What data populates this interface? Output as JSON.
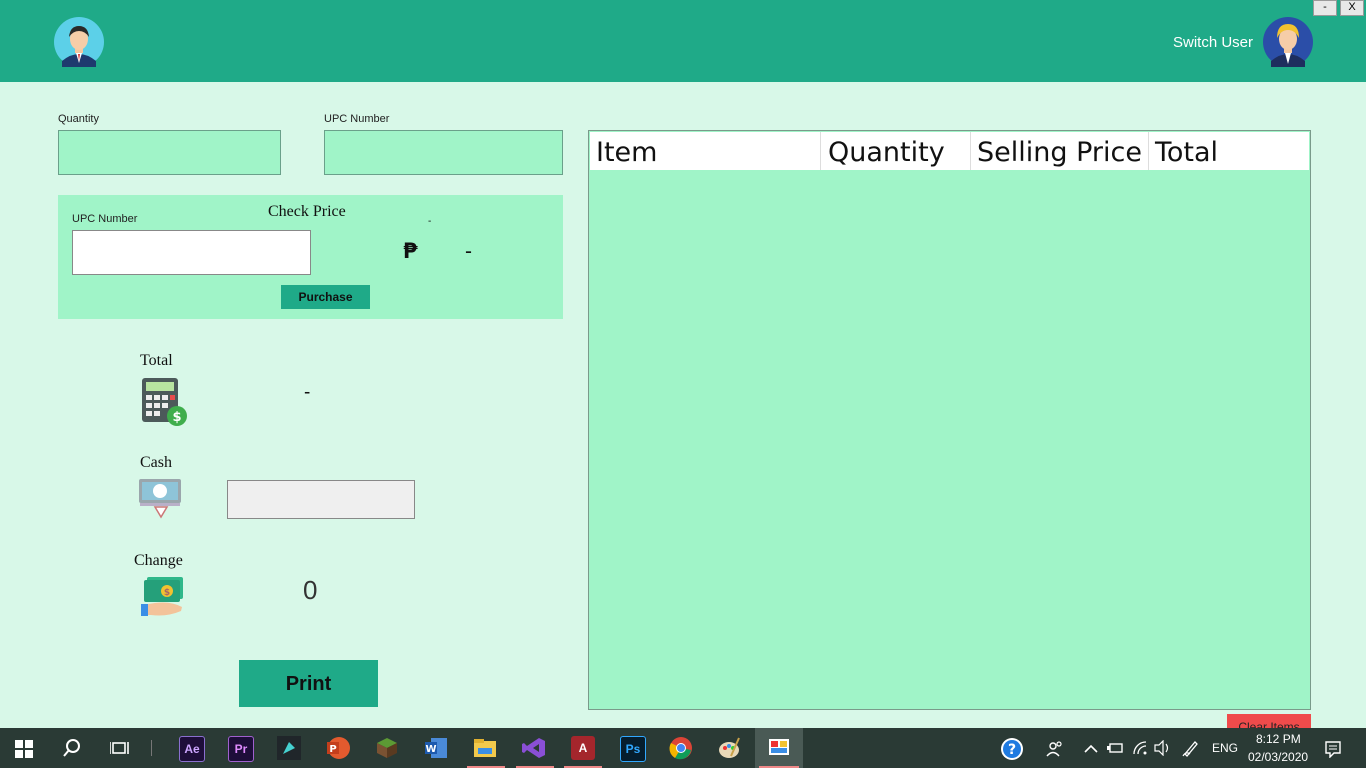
{
  "window": {
    "minimize_label": "-",
    "close_label": "X"
  },
  "header": {
    "switch_user_label": "Switch User"
  },
  "form": {
    "quantity_label": "Quantity",
    "quantity_value": "",
    "upc_label": "UPC Number",
    "upc_value": ""
  },
  "check_price": {
    "title": "Check Price",
    "upc_label": "UPC Number",
    "upc_value": "",
    "small_dash": "-",
    "currency_symbol": "₱",
    "price_value": "-",
    "purchase_label": "Purchase"
  },
  "summary": {
    "total_label": "Total",
    "total_value": "-",
    "cash_label": "Cash",
    "cash_value": "",
    "change_label": "Change",
    "change_value": "0",
    "print_label": "Print"
  },
  "table": {
    "columns": [
      "Item",
      "Quantity",
      "Selling Price",
      "Total"
    ],
    "rows": []
  },
  "clear_items_label": "Clear Items",
  "taskbar": {
    "apps": [
      "Ae",
      "Pr",
      "A",
      "Ps"
    ],
    "language": "ENG",
    "time": "8:12 PM",
    "date": "02/03/2020"
  },
  "colors": {
    "header": "#1faa88",
    "background": "#d8f8e8",
    "field": "#a0f4c8",
    "clear_button": "#ef4b4b"
  }
}
